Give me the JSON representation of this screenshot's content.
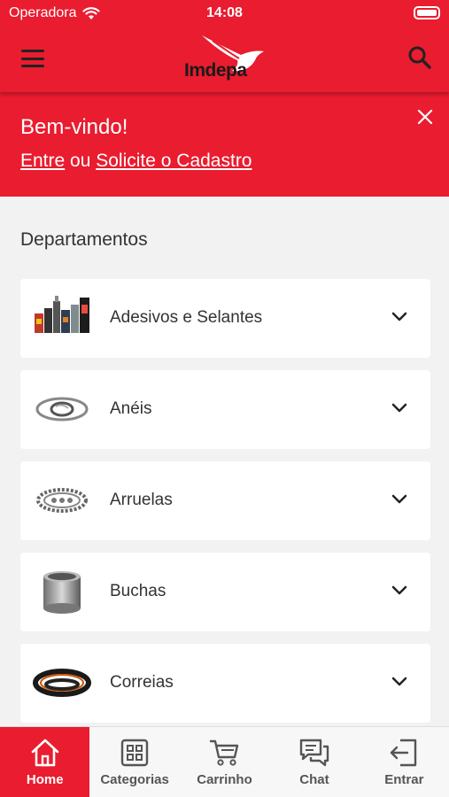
{
  "status_bar": {
    "carrier": "Operadora",
    "time": "14:08"
  },
  "header": {
    "logo_text": "Imdepa"
  },
  "welcome": {
    "title": "Bem-vindo!",
    "login_link": "Entre",
    "connector": " ou ",
    "register_link": "Solicite o Cadastro"
  },
  "departments": {
    "title": "Departamentos",
    "items": [
      {
        "label": "Adesivos e Selantes",
        "icon": "adhesives-product-icon"
      },
      {
        "label": "Anéis",
        "icon": "rings-product-icon"
      },
      {
        "label": "Arruelas",
        "icon": "washers-product-icon"
      },
      {
        "label": "Buchas",
        "icon": "bushing-product-icon"
      },
      {
        "label": "Correias",
        "icon": "belts-product-icon"
      }
    ]
  },
  "tab_bar": {
    "tabs": [
      {
        "label": "Home",
        "icon": "home-icon",
        "active": true
      },
      {
        "label": "Categorias",
        "icon": "grid-icon",
        "active": false
      },
      {
        "label": "Carrinho",
        "icon": "cart-icon",
        "active": false
      },
      {
        "label": "Chat",
        "icon": "chat-icon",
        "active": false
      },
      {
        "label": "Entrar",
        "icon": "login-icon",
        "active": false
      }
    ]
  },
  "colors": {
    "brand_red": "#ea1c2f",
    "background": "#f2f2f2",
    "text_dark": "#333333"
  }
}
